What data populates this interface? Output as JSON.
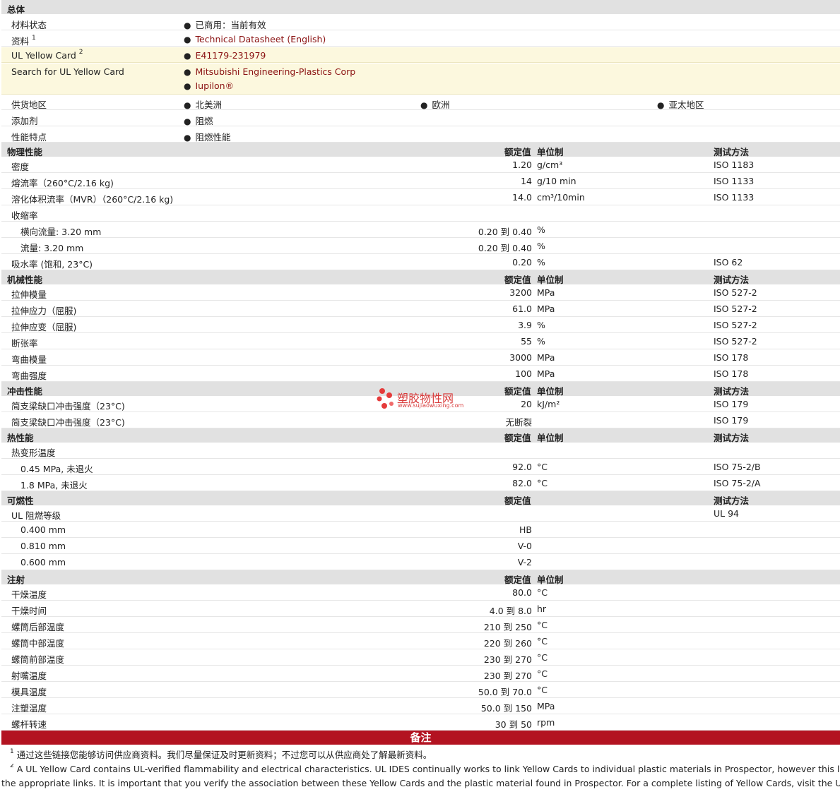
{
  "general": {
    "header": "总体",
    "material_status_label": "材料状态",
    "material_status_value": "已商用：当前有效",
    "resource_label": "资料",
    "resource_sup": "1",
    "resource_link": "Technical Datasheet (English)",
    "ul_card_label": "UL Yellow Card",
    "ul_card_sup": "2",
    "ul_card_link": "E41179-231979",
    "search_label": "Search for UL Yellow Card",
    "search_link_1": "Mitsubishi Engineering-Plastics Corp",
    "search_link_2": "Iupilon®",
    "supply_label": "供货地区",
    "supply_1": "北美洲",
    "supply_2": "欧洲",
    "supply_3": "亚太地区",
    "additive_label": "添加剂",
    "additive_value": "阻燃",
    "feature_label": "性能特点",
    "feature_value": "阻燃性能"
  },
  "headers": {
    "rated": "额定值",
    "unit": "单位制",
    "method": "测试方法"
  },
  "physical": {
    "title": "物理性能",
    "rows": [
      {
        "label": "密度",
        "value": "1.20",
        "unit": "g/cm³",
        "method": "ISO 1183"
      },
      {
        "label": "熔流率（260°C/2.16 kg)",
        "value": "14",
        "unit": "g/10 min",
        "method": "ISO 1133"
      },
      {
        "label": "溶化体积流率（MVR）（260°C/2.16 kg)",
        "value": "14.0",
        "unit": "cm³/10min",
        "method": "ISO 1133"
      },
      {
        "label": "收缩率",
        "value": "",
        "unit": "",
        "method": ""
      },
      {
        "label": "横向流量: 3.20 mm",
        "value": "0.20 到  0.40",
        "unit": "%",
        "method": "",
        "sub": true
      },
      {
        "label": "流量: 3.20 mm",
        "value": "0.20 到  0.40",
        "unit": "%",
        "method": "",
        "sub": true
      },
      {
        "label": "吸水率 (饱和, 23°C)",
        "value": "0.20",
        "unit": "%",
        "method": "ISO 62"
      }
    ]
  },
  "mechanical": {
    "title": "机械性能",
    "rows": [
      {
        "label": "拉伸模量",
        "value": "3200",
        "unit": "MPa",
        "method": "ISO 527-2"
      },
      {
        "label": "拉伸应力（屈服)",
        "value": "61.0",
        "unit": "MPa",
        "method": "ISO 527-2"
      },
      {
        "label": "拉伸应变（屈服)",
        "value": "3.9",
        "unit": "%",
        "method": "ISO 527-2"
      },
      {
        "label": "断张率",
        "value": "55",
        "unit": "%",
        "method": "ISO 527-2"
      },
      {
        "label": "弯曲模量",
        "value": "3000",
        "unit": "MPa",
        "method": "ISO 178"
      },
      {
        "label": "弯曲强度",
        "value": "100",
        "unit": "MPa",
        "method": "ISO 178"
      }
    ]
  },
  "impact": {
    "title": "冲击性能",
    "rows": [
      {
        "label": "简支梁缺口冲击强度（23°C)",
        "value": "20",
        "unit": "kJ/m²",
        "method": "ISO 179"
      },
      {
        "label": "简支梁缺口冲击强度（23°C)",
        "value": "无断裂",
        "unit": "",
        "method": "ISO 179"
      }
    ]
  },
  "thermal": {
    "title": "热性能",
    "rows": [
      {
        "label": "热变形温度",
        "value": "",
        "unit": "",
        "method": ""
      },
      {
        "label": "0.45 MPa, 未退火",
        "value": "92.0",
        "unit": "°C",
        "method": "ISO 75-2/B",
        "sub": true
      },
      {
        "label": "1.8 MPa, 未退火",
        "value": "82.0",
        "unit": "°C",
        "method": "ISO 75-2/A",
        "sub": true
      }
    ]
  },
  "flammability": {
    "title": "可燃性",
    "rows": [
      {
        "label": "UL 阻燃等级",
        "value": "",
        "unit": "",
        "method": "UL 94"
      },
      {
        "label": "0.400 mm",
        "value": "HB",
        "unit": "",
        "method": "",
        "sub": true
      },
      {
        "label": "0.810 mm",
        "value": "V-0",
        "unit": "",
        "method": "",
        "sub": true
      },
      {
        "label": "0.600 mm",
        "value": "V-2",
        "unit": "",
        "method": "",
        "sub": true
      }
    ]
  },
  "injection": {
    "title": "注射",
    "rows": [
      {
        "label": "干燥温度",
        "value": "80.0",
        "unit": "°C"
      },
      {
        "label": "干燥时间",
        "value": "4.0 到  8.0",
        "unit": "hr"
      },
      {
        "label": "螺筒后部温度",
        "value": "210 到  250",
        "unit": "°C"
      },
      {
        "label": "螺筒中部温度",
        "value": "220 到  260",
        "unit": "°C"
      },
      {
        "label": "螺筒前部温度",
        "value": "230 到  270",
        "unit": "°C"
      },
      {
        "label": "射嘴温度",
        "value": "230 到  270",
        "unit": "°C"
      },
      {
        "label": "模具温度",
        "value": "50.0 到  70.0",
        "unit": "°C"
      },
      {
        "label": "注塑温度",
        "value": "50.0 到  150",
        "unit": "MPa"
      },
      {
        "label": "螺杆转速",
        "value": "30 到  50",
        "unit": "rpm"
      }
    ]
  },
  "notes": {
    "title": "备注",
    "note1_sup": "1",
    "note1": "通过这些链接您能够访问供应商资料。我们尽量保证及时更新资料；不过您可以从供应商处了解最新资料。",
    "note2_sup": "2",
    "note2_line1": "A UL Yellow Card contains UL-verified flammability and electrical characteristics. UL IDES continually works to link Yellow Cards to individual plastic materials in Prospector, however this list may not inc",
    "note2_line2": "the appropriate links. It is important that you verify the association between these Yellow Cards and the plastic material found in Prospector. For a complete listing of Yellow Cards, visit the UL Yellow Card S"
  },
  "watermark": {
    "name": "塑胶物性网",
    "url": "www.sujiaowuxing.com"
  },
  "colors": {
    "link": "#8a1111",
    "footer_bar": "#b31321",
    "header_bg": "#e1e1e1",
    "yellow_bg": "#fcf8de"
  }
}
